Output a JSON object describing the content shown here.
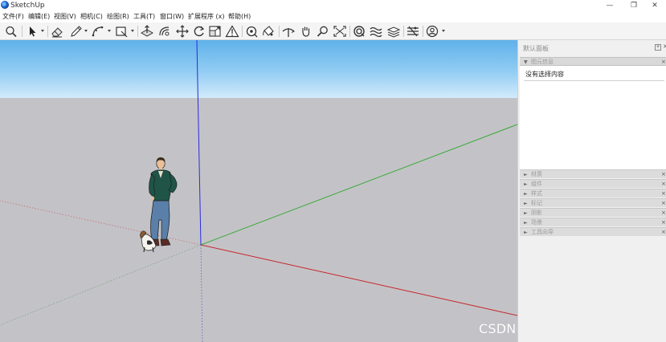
{
  "window": {
    "title": "SketchUp",
    "minimize_glyph": "—",
    "restore_glyph": "❐",
    "close_glyph": "✕"
  },
  "menu": [
    {
      "label": "文件(F)"
    },
    {
      "label": "编辑(E)"
    },
    {
      "label": "视图(V)"
    },
    {
      "label": "相机(C)"
    },
    {
      "label": "绘图(R)"
    },
    {
      "label": "工具(T)"
    },
    {
      "label": "窗口(W)"
    },
    {
      "label": "扩展程序 (x)"
    },
    {
      "label": "帮助(H)"
    }
  ],
  "toolbar": {
    "tools": [
      "search-icon",
      "select-arrow-icon",
      "eraser-icon",
      "pencil-line-icon",
      "arc-icon",
      "rectangle-icon",
      "push-pull-icon",
      "offset-icon",
      "move-icon",
      "rotate-icon",
      "scale-icon",
      "follow-me-icon",
      "tape-measure-icon",
      "paint-bucket-icon",
      "orbit-icon",
      "pan-icon",
      "walk-icon",
      "zoom-icon",
      "zoom-extents-icon",
      "3d-warehouse-icon",
      "extension-warehouse-icon",
      "layout-icon",
      "extension-manager-icon",
      "account-icon"
    ]
  },
  "viewport": {
    "sky_color": "#7cc0ef",
    "ground_color": "#c3c3c7",
    "axis_colors": {
      "red": "#c8242a",
      "green": "#37a834",
      "blue": "#2a2ae0"
    }
  },
  "watermark": "CSDN @不称职的程序员",
  "tray": {
    "title": "默认面板",
    "pin_glyph": "+",
    "close_glyph": "×",
    "entity_panel": {
      "label": "图元信息",
      "arrow": "▼",
      "empty_text": "没有选择内容"
    },
    "collapsed_arrow": "►",
    "panels": [
      {
        "label": "材质"
      },
      {
        "label": "组件"
      },
      {
        "label": "样式"
      },
      {
        "label": "标记"
      },
      {
        "label": "阴影"
      },
      {
        "label": "场景"
      },
      {
        "label": "工具向导"
      }
    ]
  }
}
